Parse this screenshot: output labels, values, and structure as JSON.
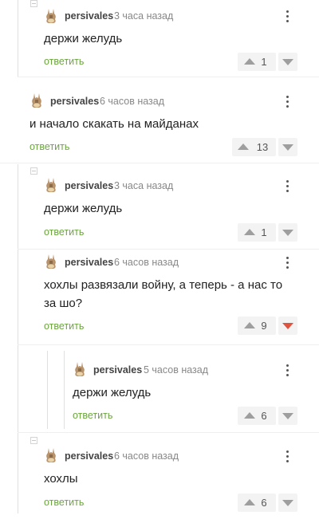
{
  "comments": [
    {
      "author": "persivales",
      "time": "3 часа назад",
      "text": "держи желудь",
      "reply_label": "ответить",
      "rating": "1",
      "down_active": false
    },
    {
      "author": "persivales",
      "time": "6 часов назад",
      "text": "и начало скакать на майданах",
      "reply_label": "ответить",
      "rating": "13",
      "down_active": false
    },
    {
      "author": "persivales",
      "time": "3 часа назад",
      "text": "держи желудь",
      "reply_label": "ответить",
      "rating": "1",
      "down_active": false
    },
    {
      "author": "persivales",
      "time": "6 часов назад",
      "text_line1": "хохлы развязали войну, а теперь - а нас то",
      "text_line2": "за шо?",
      "reply_label": "ответить",
      "rating": "9",
      "down_active": true
    },
    {
      "author": "persivales",
      "time": "5 часов назад",
      "text": "держи желудь",
      "reply_label": "ответить",
      "rating": "6",
      "down_active": false
    },
    {
      "author": "persivales",
      "time": "6 часов назад",
      "text": "хохлы",
      "reply_label": "ответить",
      "rating": "6",
      "down_active": false
    }
  ],
  "colors": {
    "reply": "#6ca63f",
    "downvote_active": "#e0533f",
    "vote_bg": "#f3f3f3"
  },
  "icons": {
    "avatar": "bunny-avatar-icon",
    "menu": "more-vertical-icon",
    "up": "upvote-arrow-icon",
    "down": "downvote-arrow-icon"
  }
}
